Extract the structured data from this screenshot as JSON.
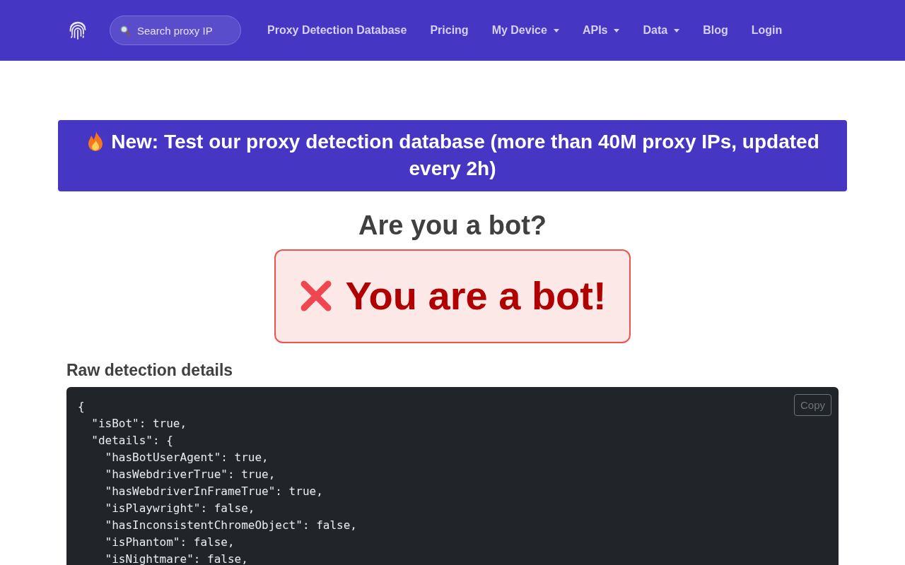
{
  "header": {
    "search": {
      "placeholder": "Search proxy IP"
    },
    "nav": [
      {
        "label": "Proxy Detection Database",
        "dropdown": false
      },
      {
        "label": "Pricing",
        "dropdown": false
      },
      {
        "label": "My Device",
        "dropdown": true
      },
      {
        "label": "APIs",
        "dropdown": true
      },
      {
        "label": "Data",
        "dropdown": true
      },
      {
        "label": "Blog",
        "dropdown": false
      },
      {
        "label": "Login",
        "dropdown": false
      }
    ]
  },
  "banner": {
    "text": "New: Test our proxy detection database (more than 40M proxy IPs, updated every 2h)"
  },
  "title": "Are you a bot?",
  "result": {
    "is_bot": true,
    "text": "You are a bot!"
  },
  "raw_details": {
    "heading": "Raw detection details",
    "copy_button": "Copy",
    "code_lines": [
      "{",
      "  \"isBot\": true,",
      "  \"details\": {",
      "    \"hasBotUserAgent\": true,",
      "    \"hasWebdriverTrue\": true,",
      "    \"hasWebdriverInFrameTrue\": true,",
      "    \"isPlaywright\": false,",
      "    \"hasInconsistentChromeObject\": false,",
      "    \"isPhantom\": false,",
      "    \"isNightmare\": false,"
    ]
  }
}
